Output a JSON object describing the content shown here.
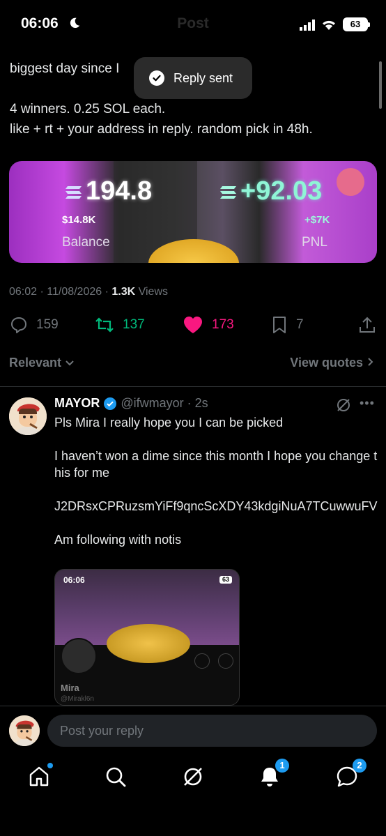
{
  "status_bar": {
    "time": "06:06",
    "battery": "63"
  },
  "header": {
    "title": "Post"
  },
  "toast": {
    "text": "Reply sent"
  },
  "post": {
    "text_line1": "biggest day since I",
    "text_line2": "4 winners. 0.25 SOL each.",
    "text_line3": "like + rt + your address in reply. random pick in 48h."
  },
  "media": {
    "balance_value": "194.8",
    "balance_usd": "$14.8K",
    "balance_label": "Balance",
    "pnl_value": "+92.03",
    "pnl_usd": "+$7K",
    "pnl_label": "PNL"
  },
  "meta": {
    "time": "06:02 · 11/08/2026 · ",
    "views_count": "1.3K",
    "views_label": " Views"
  },
  "actions": {
    "replies": "159",
    "reposts": "137",
    "likes": "173",
    "bookmarks": "7"
  },
  "sort": {
    "relevant": "Relevant",
    "view_quotes": "View quotes"
  },
  "reply": {
    "name": "MAYOR",
    "handle": "@ifwmayor · 2s",
    "paragraphs": [
      "Pls Mira I really hope you I can be picked",
      "I haven’t won a dime since this month I hope you change this for me",
      "J2DRsxCPRuzsmYiFf9qncScXDY43kdgiNuA7TCuwwuFV",
      "Am following with notis"
    ],
    "embed": {
      "time": "06:06",
      "battery": "63",
      "name": "Mira",
      "handle": "@Mirakl6n"
    }
  },
  "reply_bar": {
    "placeholder": "Post your reply"
  },
  "tabbar": {
    "notifications_badge": "1",
    "messages_badge": "2"
  },
  "colors": {
    "accent": "#1d9bf0",
    "like": "#f91880",
    "repost": "#00ba7c",
    "muted": "#71767b"
  }
}
